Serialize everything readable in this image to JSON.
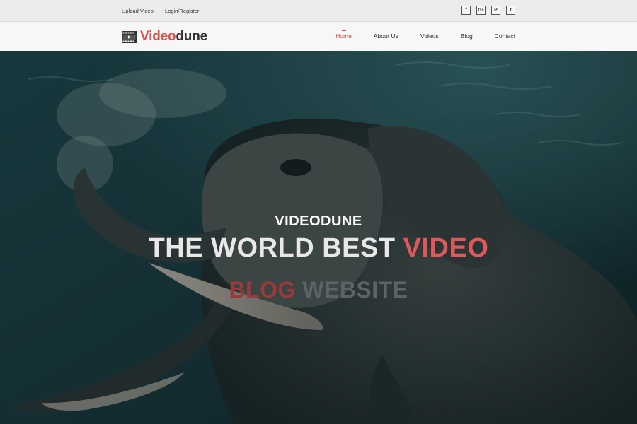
{
  "topbar": {
    "links": [
      "Upload Video",
      "Login/Register"
    ],
    "social": [
      {
        "icon": "facebook-icon",
        "glyph": "f"
      },
      {
        "icon": "google-plus-icon",
        "glyph": "G+"
      },
      {
        "icon": "pinterest-icon",
        "glyph": "P"
      },
      {
        "icon": "twitter-icon",
        "glyph": "t"
      }
    ]
  },
  "logo": {
    "part1": "Video",
    "part2": "dune"
  },
  "nav": {
    "items": [
      "Home",
      "About Us",
      "Videos",
      "Blog",
      "Contact"
    ],
    "active": "Home"
  },
  "hero": {
    "eyebrow": "VIDEODUNE",
    "headline_main": "THE WORLD BEST",
    "headline_accent": "VIDEO",
    "subline_accent": "BLOG",
    "subline_main": "WEBSITE"
  },
  "colors": {
    "accent": "#d9534f",
    "dark": "#333333"
  }
}
